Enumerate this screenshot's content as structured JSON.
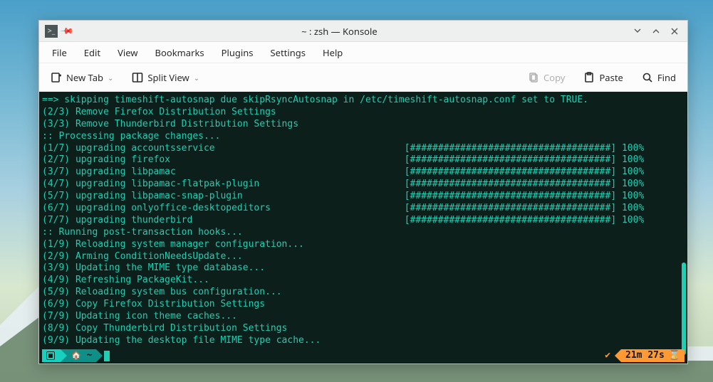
{
  "titlebar": {
    "title": "~ : zsh — Konsole"
  },
  "menubar": {
    "items": [
      "File",
      "Edit",
      "View",
      "Bookmarks",
      "Plugins",
      "Settings",
      "Help"
    ]
  },
  "toolbar": {
    "new_tab": "New Tab",
    "split_view": "Split View",
    "copy": "Copy",
    "paste": "Paste",
    "find": "Find"
  },
  "terminal": {
    "lines": [
      "==> skipping timeshift-autosnap due skipRsyncAutosnap in /etc/timeshift-autosnap.conf set to TRUE.",
      "(2/3) Remove Firefox Distribution Settings",
      "(3/3) Remove Thunderbird Distribution Settings",
      ":: Processing package changes...",
      "(1/7) upgrading accountsservice                                  [####################################] 100%",
      "(2/7) upgrading firefox                                          [####################################] 100%",
      "(3/7) upgrading libpamac                                         [####################################] 100%",
      "(4/7) upgrading libpamac-flatpak-plugin                          [####################################] 100%",
      "(5/7) upgrading libpamac-snap-plugin                             [####################################] 100%",
      "(6/7) upgrading onlyoffice-desktopeditors                        [####################################] 100%",
      "(7/7) upgrading thunderbird                                      [####################################] 100%",
      ":: Running post-transaction hooks...",
      "(1/9) Reloading system manager configuration...",
      "(2/9) Arming ConditionNeedsUpdate...",
      "(3/9) Updating the MIME type database...",
      "(4/9) Refreshing PackageKit...",
      "(5/9) Reloading system bus configuration...",
      "(6/9) Copy Firefox Distribution Settings",
      "(7/9) Updating icon theme caches...",
      "(8/9) Copy Thunderbird Distribution Settings",
      "(9/9) Updating the desktop file MIME type cache..."
    ],
    "prompt": {
      "path_short": "~",
      "elapsed": "21m 27s"
    }
  }
}
